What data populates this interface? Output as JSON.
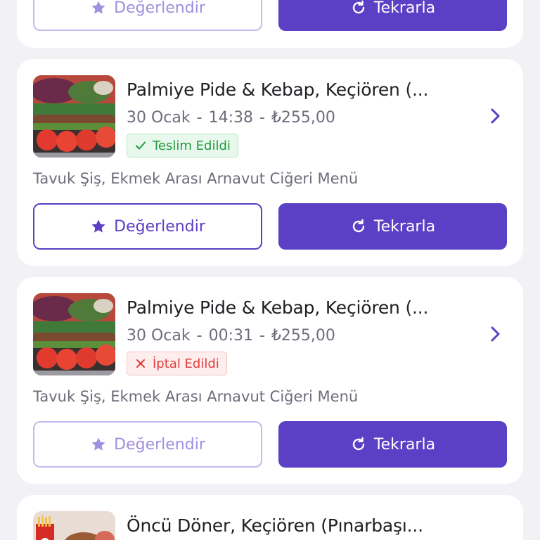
{
  "top_card": {
    "rate_label": "Değerlendir",
    "repeat_label": "Tekrarla"
  },
  "orders": [
    {
      "restaurant": "Palmiye Pide & Kebap, Keçiören (...",
      "date": "30 Ocak",
      "time": "14:38",
      "price": "₺255,00",
      "status": "Teslim Edildi",
      "items": "Tavuk Şiş, Ekmek Arası Arnavut Ciğeri Menü",
      "rate_label": "Değerlendir",
      "repeat_label": "Tekrarla"
    },
    {
      "restaurant": "Palmiye Pide & Kebap, Keçiören (...",
      "date": "30 Ocak",
      "time": "00:31",
      "price": "₺255,00",
      "status": "İptal Edildi",
      "items": "Tavuk Şiş, Ekmek Arası Arnavut Ciğeri Menü",
      "rate_label": "Değerlendir",
      "repeat_label": "Tekrarla"
    },
    {
      "restaurant": "Öncü Döner, Keçiören (Pınarbaşı..."
    }
  ],
  "meta_separator": "-",
  "colors": {
    "brand_purple": "#5b3fc4",
    "delivered_green": "#1f9a3c",
    "cancelled_red": "#e23b3b",
    "muted_text": "#6d6d7c"
  }
}
